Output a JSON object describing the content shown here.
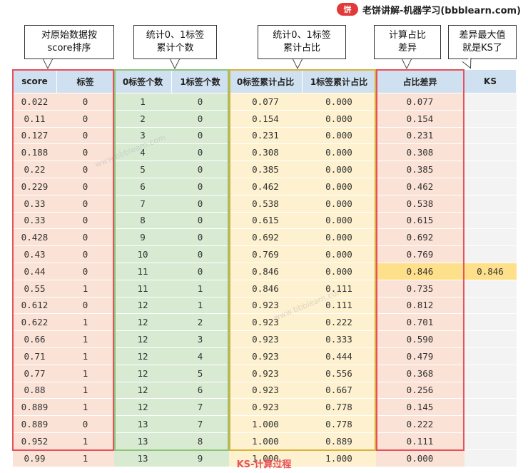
{
  "brand": {
    "badge": "饼",
    "text": "老饼讲解-机器学习(bbblearn.com)"
  },
  "callouts": {
    "sort_line1": "对原始数据按",
    "sort_line2": "score排序",
    "count_line1": "统计0、1标签",
    "count_line2": "累计个数",
    "ratio_line1": "统计0、1标签",
    "ratio_line2": "累计占比",
    "diff_line1": "计算占比",
    "diff_line2": "差异",
    "ks_line1": "差异最大值",
    "ks_line2": "就是KS了"
  },
  "headers": [
    "score",
    "标签",
    "0标签个数",
    "1标签个数",
    "0标签累计占比",
    "1标签累计占比",
    "占比差异",
    "KS"
  ],
  "rows": [
    [
      "0.022",
      "0",
      "1",
      "0",
      "0.077",
      "0.000",
      "0.077",
      ""
    ],
    [
      "0.11",
      "0",
      "2",
      "0",
      "0.154",
      "0.000",
      "0.154",
      ""
    ],
    [
      "0.127",
      "0",
      "3",
      "0",
      "0.231",
      "0.000",
      "0.231",
      ""
    ],
    [
      "0.188",
      "0",
      "4",
      "0",
      "0.308",
      "0.000",
      "0.308",
      ""
    ],
    [
      "0.22",
      "0",
      "5",
      "0",
      "0.385",
      "0.000",
      "0.385",
      ""
    ],
    [
      "0.229",
      "0",
      "6",
      "0",
      "0.462",
      "0.000",
      "0.462",
      ""
    ],
    [
      "0.33",
      "0",
      "7",
      "0",
      "0.538",
      "0.000",
      "0.538",
      ""
    ],
    [
      "0.33",
      "0",
      "8",
      "0",
      "0.615",
      "0.000",
      "0.615",
      ""
    ],
    [
      "0.428",
      "0",
      "9",
      "0",
      "0.692",
      "0.000",
      "0.692",
      ""
    ],
    [
      "0.43",
      "0",
      "10",
      "0",
      "0.769",
      "0.000",
      "0.769",
      ""
    ],
    [
      "0.44",
      "0",
      "11",
      "0",
      "0.846",
      "0.000",
      "0.846",
      "0.846"
    ],
    [
      "0.55",
      "1",
      "11",
      "1",
      "0.846",
      "0.111",
      "0.735",
      ""
    ],
    [
      "0.612",
      "0",
      "12",
      "1",
      "0.923",
      "0.111",
      "0.812",
      ""
    ],
    [
      "0.622",
      "1",
      "12",
      "2",
      "0.923",
      "0.222",
      "0.701",
      ""
    ],
    [
      "0.66",
      "1",
      "12",
      "3",
      "0.923",
      "0.333",
      "0.590",
      ""
    ],
    [
      "0.71",
      "1",
      "12",
      "4",
      "0.923",
      "0.444",
      "0.479",
      ""
    ],
    [
      "0.77",
      "1",
      "12",
      "5",
      "0.923",
      "0.556",
      "0.368",
      ""
    ],
    [
      "0.88",
      "1",
      "12",
      "6",
      "0.923",
      "0.667",
      "0.256",
      ""
    ],
    [
      "0.889",
      "1",
      "12",
      "7",
      "0.923",
      "0.778",
      "0.145",
      ""
    ],
    [
      "0.889",
      "0",
      "13",
      "7",
      "1.000",
      "0.778",
      "0.222",
      ""
    ],
    [
      "0.952",
      "1",
      "13",
      "8",
      "1.000",
      "0.889",
      "0.111",
      ""
    ],
    [
      "0.99",
      "1",
      "13",
      "9",
      "1.000",
      "1.000",
      "0.000",
      ""
    ]
  ],
  "highlight_row": 10,
  "caption": "KS-计算过程",
  "watermark": "www.bbblearn.com",
  "colors": {
    "red": "#e8505b",
    "green": "#8fc47a",
    "gold": "#d9b23c",
    "header": "#cfe0f0"
  }
}
